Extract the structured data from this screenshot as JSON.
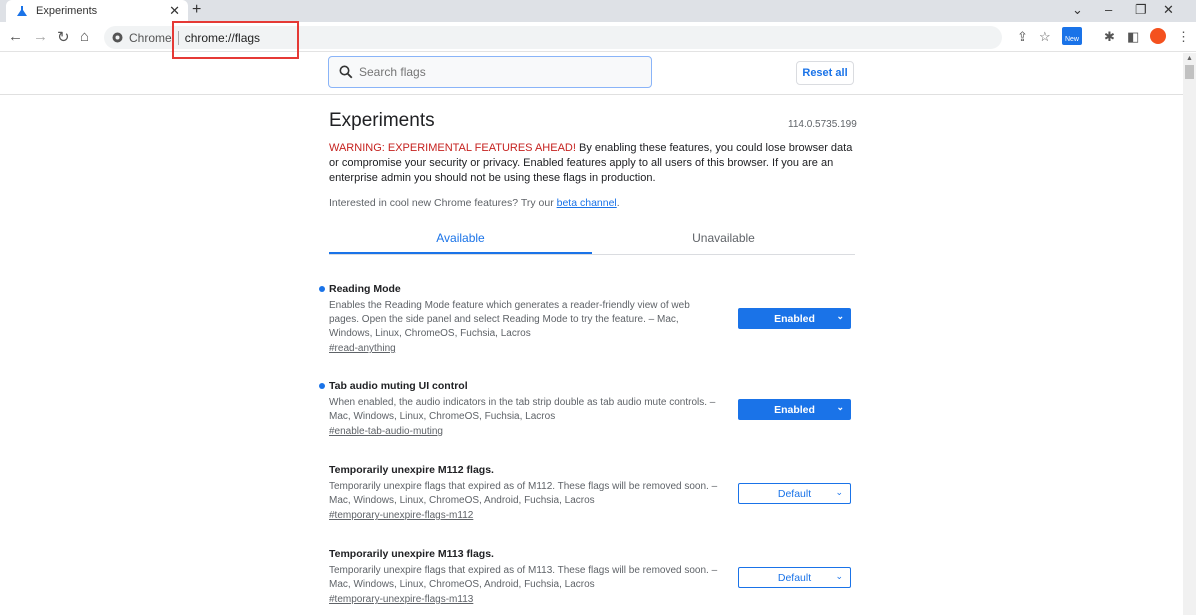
{
  "browser": {
    "tab_title": "Experiments",
    "new_tab": "+",
    "omnibox_chip": "Chrome",
    "url": "chrome://flags"
  },
  "header": {
    "search_placeholder": "Search flags",
    "reset_label": "Reset all"
  },
  "page": {
    "title": "Experiments",
    "version": "114.0.5735.199",
    "warning_red": "WARNING: EXPERIMENTAL FEATURES AHEAD!",
    "warning_text": " By enabling these features, you could lose browser data or compromise your security or privacy. Enabled features apply to all users of this browser. If you are an enterprise admin you should not be using these flags in production.",
    "interest_text": "Interested in cool new Chrome features? Try our ",
    "interest_link": "beta channel",
    "interest_end": ".",
    "tabs": [
      "Available",
      "Unavailable"
    ]
  },
  "flags": [
    {
      "name": "Reading Mode",
      "desc": "Enables the Reading Mode feature which generates a reader-friendly view of web pages. Open the side panel and select Reading Mode to try the feature. – Mac, Windows, Linux, ChromeOS, Fuchsia, Lacros",
      "permalink": "#read-anything",
      "value": "Enabled"
    },
    {
      "name": "Tab audio muting UI control",
      "desc": "When enabled, the audio indicators in the tab strip double as tab audio mute controls. – Mac, Windows, Linux, ChromeOS, Fuchsia, Lacros",
      "permalink": "#enable-tab-audio-muting",
      "value": "Enabled"
    },
    {
      "name": "Temporarily unexpire M112 flags.",
      "desc": "Temporarily unexpire flags that expired as of M112. These flags will be removed soon. – Mac, Windows, Linux, ChromeOS, Android, Fuchsia, Lacros",
      "permalink": "#temporary-unexpire-flags-m112",
      "value": "Default"
    },
    {
      "name": "Temporarily unexpire M113 flags.",
      "desc": "Temporarily unexpire flags that expired as of M113. These flags will be removed soon. – Mac, Windows, Linux, ChromeOS, Android, Fuchsia, Lacros",
      "permalink": "#temporary-unexpire-flags-m113",
      "value": "Default"
    }
  ],
  "colors": {
    "accent": "#1a73e8",
    "warning": "#c5221f",
    "highlight_box": "#e53935"
  }
}
